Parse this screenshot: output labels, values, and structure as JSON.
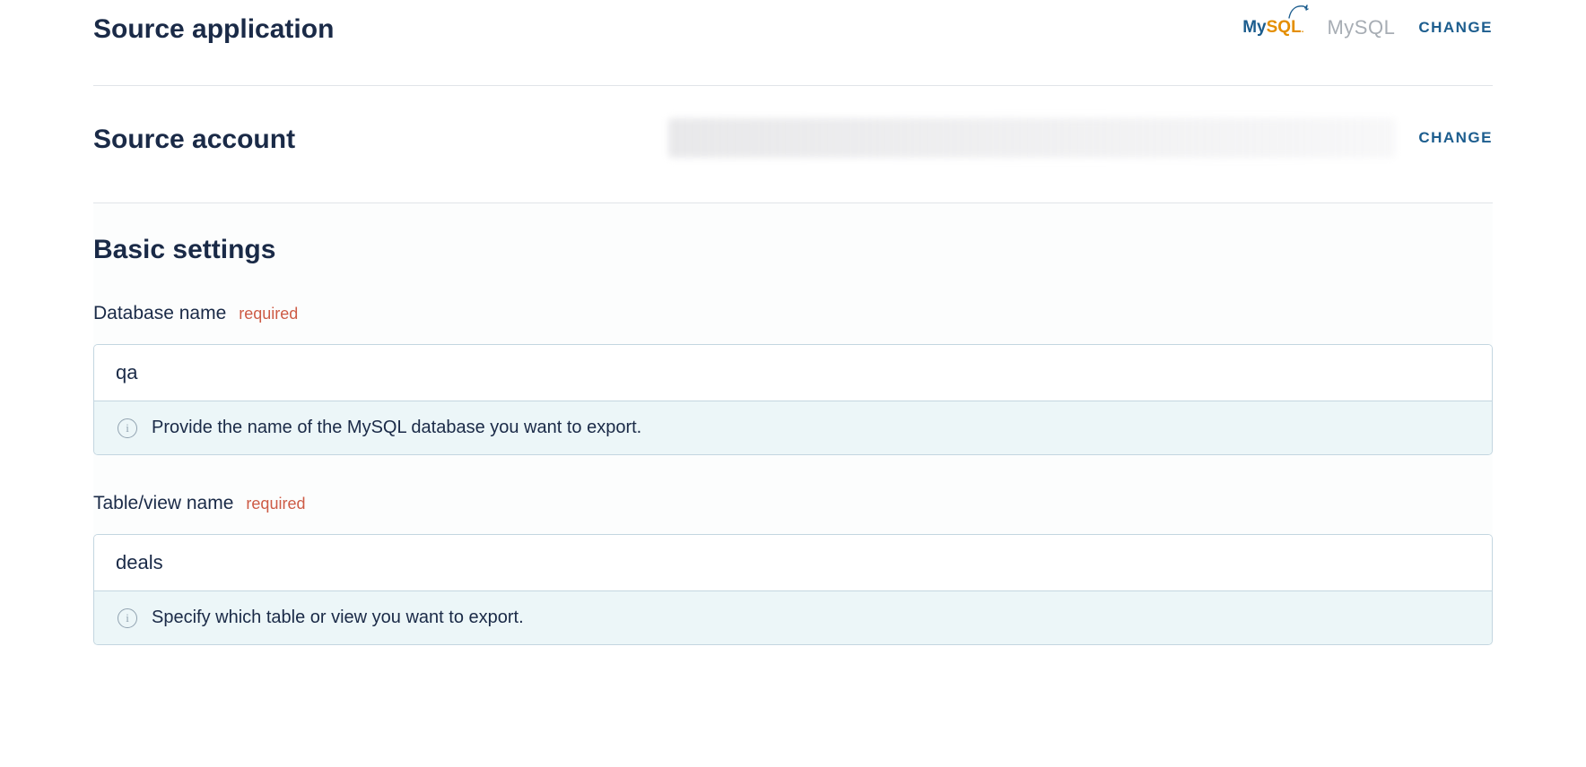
{
  "source_application": {
    "heading": "Source application",
    "app_name": "MySQL",
    "action": "CHANGE"
  },
  "source_account": {
    "heading": "Source account",
    "action": "CHANGE"
  },
  "basic_settings": {
    "heading": "Basic settings",
    "required_label": "required",
    "database_name": {
      "label": "Database name",
      "value": "qa",
      "help": "Provide the name of the MySQL database you want to export."
    },
    "table_view_name": {
      "label": "Table/view name",
      "value": "deals",
      "help": "Specify which table or view you want to export."
    }
  },
  "info_glyph": "i"
}
